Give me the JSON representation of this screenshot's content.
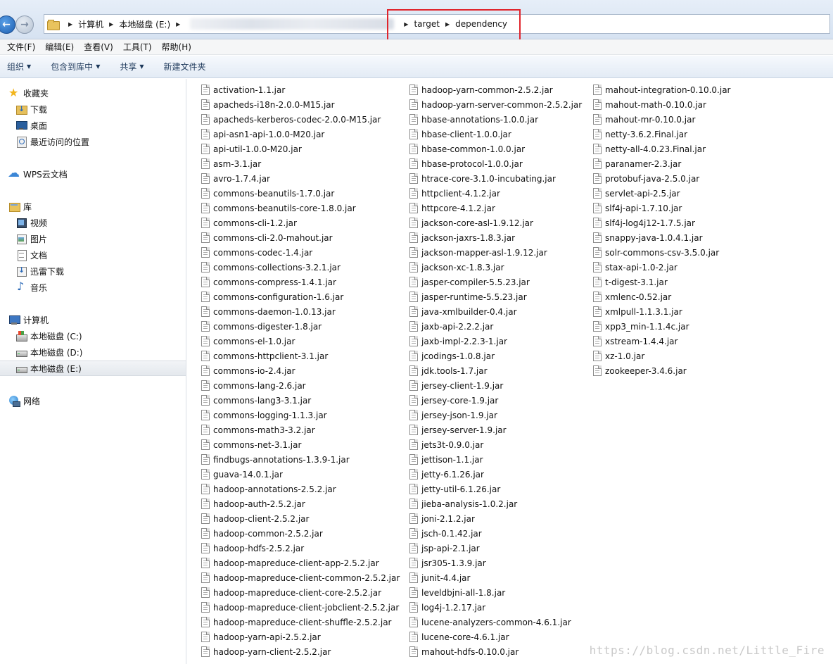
{
  "address": {
    "crumbs_left": [
      "计算机",
      "本地磁盘 (E:)"
    ],
    "crumbs_right": [
      "target",
      "dependency"
    ]
  },
  "menu": [
    "文件(F)",
    "编辑(E)",
    "查看(V)",
    "工具(T)",
    "帮助(H)"
  ],
  "toolbar": {
    "organize": "组织",
    "include_library": "包含到库中",
    "share": "共享",
    "new_folder": "新建文件夹"
  },
  "sidebar": {
    "favorites": {
      "label": "收藏夹",
      "items": [
        "下载",
        "桌面",
        "最近访问的位置"
      ]
    },
    "wps": {
      "label": "WPS云文档"
    },
    "libraries": {
      "label": "库",
      "items": [
        "视频",
        "图片",
        "文档",
        "迅雷下载",
        "音乐"
      ]
    },
    "computer": {
      "label": "计算机",
      "items": [
        "本地磁盘 (C:)",
        "本地磁盘 (D:)",
        "本地磁盘 (E:)"
      ]
    },
    "network": {
      "label": "网络"
    }
  },
  "files": {
    "col1": [
      "activation-1.1.jar",
      "apacheds-i18n-2.0.0-M15.jar",
      "apacheds-kerberos-codec-2.0.0-M15.jar",
      "api-asn1-api-1.0.0-M20.jar",
      "api-util-1.0.0-M20.jar",
      "asm-3.1.jar",
      "avro-1.7.4.jar",
      "commons-beanutils-1.7.0.jar",
      "commons-beanutils-core-1.8.0.jar",
      "commons-cli-1.2.jar",
      "commons-cli-2.0-mahout.jar",
      "commons-codec-1.4.jar",
      "commons-collections-3.2.1.jar",
      "commons-compress-1.4.1.jar",
      "commons-configuration-1.6.jar",
      "commons-daemon-1.0.13.jar",
      "commons-digester-1.8.jar",
      "commons-el-1.0.jar",
      "commons-httpclient-3.1.jar",
      "commons-io-2.4.jar",
      "commons-lang-2.6.jar",
      "commons-lang3-3.1.jar",
      "commons-logging-1.1.3.jar",
      "commons-math3-3.2.jar",
      "commons-net-3.1.jar",
      "findbugs-annotations-1.3.9-1.jar",
      "guava-14.0.1.jar",
      "hadoop-annotations-2.5.2.jar",
      "hadoop-auth-2.5.2.jar",
      "hadoop-client-2.5.2.jar",
      "hadoop-common-2.5.2.jar",
      "hadoop-hdfs-2.5.2.jar",
      "hadoop-mapreduce-client-app-2.5.2.jar",
      "hadoop-mapreduce-client-common-2.5.2.jar",
      "hadoop-mapreduce-client-core-2.5.2.jar",
      "hadoop-mapreduce-client-jobclient-2.5.2.jar",
      "hadoop-mapreduce-client-shuffle-2.5.2.jar",
      "hadoop-yarn-api-2.5.2.jar",
      "hadoop-yarn-client-2.5.2.jar"
    ],
    "col2": [
      "hadoop-yarn-common-2.5.2.jar",
      "hadoop-yarn-server-common-2.5.2.jar",
      "hbase-annotations-1.0.0.jar",
      "hbase-client-1.0.0.jar",
      "hbase-common-1.0.0.jar",
      "hbase-protocol-1.0.0.jar",
      "htrace-core-3.1.0-incubating.jar",
      "httpclient-4.1.2.jar",
      "httpcore-4.1.2.jar",
      "jackson-core-asl-1.9.12.jar",
      "jackson-jaxrs-1.8.3.jar",
      "jackson-mapper-asl-1.9.12.jar",
      "jackson-xc-1.8.3.jar",
      "jasper-compiler-5.5.23.jar",
      "jasper-runtime-5.5.23.jar",
      "java-xmlbuilder-0.4.jar",
      "jaxb-api-2.2.2.jar",
      "jaxb-impl-2.2.3-1.jar",
      "jcodings-1.0.8.jar",
      "jdk.tools-1.7.jar",
      "jersey-client-1.9.jar",
      "jersey-core-1.9.jar",
      "jersey-json-1.9.jar",
      "jersey-server-1.9.jar",
      "jets3t-0.9.0.jar",
      "jettison-1.1.jar",
      "jetty-6.1.26.jar",
      "jetty-util-6.1.26.jar",
      "jieba-analysis-1.0.2.jar",
      "joni-2.1.2.jar",
      "jsch-0.1.42.jar",
      "jsp-api-2.1.jar",
      "jsr305-1.3.9.jar",
      "junit-4.4.jar",
      "leveldbjni-all-1.8.jar",
      "log4j-1.2.17.jar",
      "lucene-analyzers-common-4.6.1.jar",
      "lucene-core-4.6.1.jar",
      "mahout-hdfs-0.10.0.jar"
    ],
    "col3": [
      "mahout-integration-0.10.0.jar",
      "mahout-math-0.10.0.jar",
      "mahout-mr-0.10.0.jar",
      "netty-3.6.2.Final.jar",
      "netty-all-4.0.23.Final.jar",
      "paranamer-2.3.jar",
      "protobuf-java-2.5.0.jar",
      "servlet-api-2.5.jar",
      "slf4j-api-1.7.10.jar",
      "slf4j-log4j12-1.7.5.jar",
      "snappy-java-1.0.4.1.jar",
      "solr-commons-csv-3.5.0.jar",
      "stax-api-1.0-2.jar",
      "t-digest-3.1.jar",
      "xmlenc-0.52.jar",
      "xmlpull-1.1.3.1.jar",
      "xpp3_min-1.1.4c.jar",
      "xstream-1.4.4.jar",
      "xz-1.0.jar",
      "zookeeper-3.4.6.jar"
    ]
  },
  "watermark": "https://blog.csdn.net/Little_Fire"
}
